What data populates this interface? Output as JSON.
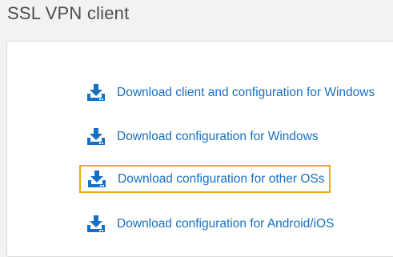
{
  "page": {
    "title": "SSL VPN client"
  },
  "colors": {
    "link": "#1670c4",
    "highlight": "#f2a81d",
    "title": "#4d4d4d"
  },
  "downloads": [
    {
      "label": "Download client and configuration for Windows",
      "icon": "download-icon"
    },
    {
      "label": "Download configuration for Windows",
      "icon": "download-icon"
    },
    {
      "label": "Download configuration for other OSs",
      "icon": "download-icon",
      "highlighted": true
    },
    {
      "label": "Download configuration for Android/iOS",
      "icon": "download-icon"
    }
  ]
}
